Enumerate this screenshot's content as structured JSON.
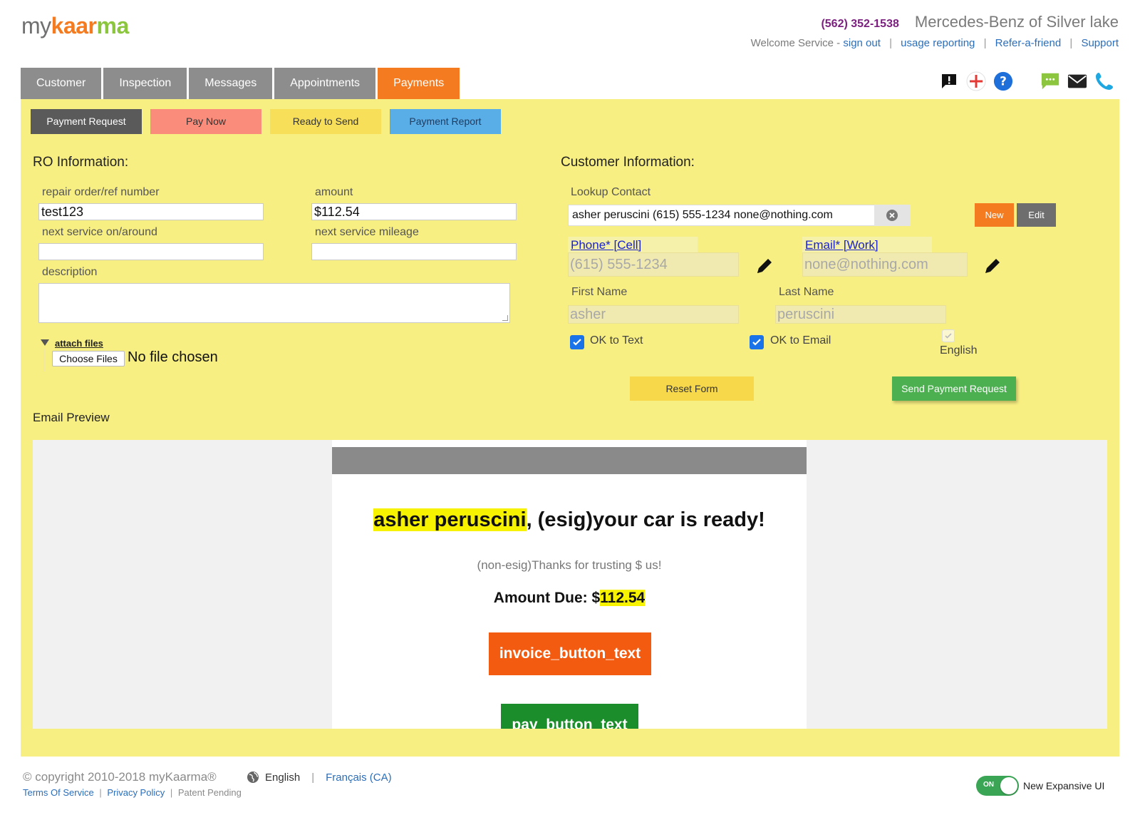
{
  "header": {
    "logo": {
      "my": "my",
      "brand": "kaar",
      "ma": "ma"
    },
    "phone": "(562) 352-1538",
    "dealer": "Mercedes-Benz of Silver lake",
    "welcome": "Welcome Service -",
    "sign_out": "sign out",
    "usage_reporting": "usage reporting",
    "refer": "Refer-a-friend",
    "support": "Support"
  },
  "tabs": [
    {
      "label": "Customer"
    },
    {
      "label": "Inspection"
    },
    {
      "label": "Messages"
    },
    {
      "label": "Appointments"
    },
    {
      "label": "Payments",
      "active": true
    }
  ],
  "toolbar_icons": [
    "alert-chat-icon",
    "plus-icon",
    "help-icon",
    "chat-icon",
    "mail-icon",
    "phone-icon"
  ],
  "subtabs": {
    "payment_request": "Payment Request",
    "pay_now": "Pay Now",
    "ready_to_send": "Ready to Send",
    "payment_report": "Payment Report"
  },
  "ro": {
    "title": "RO Information:",
    "repair_order_label": "repair order/ref number",
    "repair_order_value": "test123",
    "amount_label": "amount",
    "amount_value": "$112.54",
    "next_service_label": "next service on/around",
    "next_service_value": "",
    "mileage_label": "next service mileage",
    "mileage_value": "",
    "description_label": "description",
    "attach_files": "attach files",
    "choose_files": "Choose Files",
    "no_file": "No file chosen"
  },
  "customer": {
    "title": "Customer Information:",
    "lookup_label": "Lookup Contact",
    "lookup_value": "asher peruscini (615) 555-1234 none@nothing.com",
    "new_btn": "New",
    "edit_btn": "Edit",
    "phone_link": "Phone* [Cell]",
    "phone_value": "(615) 555-1234",
    "email_link": "Email* [Work]",
    "email_value": "none@nothing.com",
    "first_name_label": "First Name",
    "first_name_value": "asher",
    "last_name_label": "Last Name",
    "last_name_value": "peruscini",
    "ok_text": "OK to Text",
    "ok_email": "OK to Email",
    "language": "English",
    "reset": "Reset Form",
    "send": "Send Payment Request"
  },
  "preview": {
    "title": "Email Preview",
    "name": "asher peruscini",
    "headline_rest": ", (esig)your car is ready!",
    "thanks": "(non-esig)Thanks for trusting $ us!",
    "amount_prefix": "Amount Due: $",
    "amount": "112.54",
    "invoice_button": "invoice_button_text",
    "pay_button": "pay_button_text"
  },
  "footer": {
    "copyright": "© copyright 2010-2018 myKaarma®",
    "lang_en": "English",
    "lang_fr": "Français (CA)",
    "terms": "Terms Of Service",
    "privacy": "Privacy Policy",
    "patent": "Patent Pending",
    "toggle_on": "ON",
    "toggle_label": "New Expansive UI"
  },
  "colors": {
    "accent_orange": "#f47b20",
    "panel_yellow": "#f8ef82",
    "send_green": "#4caf50",
    "link_blue": "#2a6ebb"
  }
}
